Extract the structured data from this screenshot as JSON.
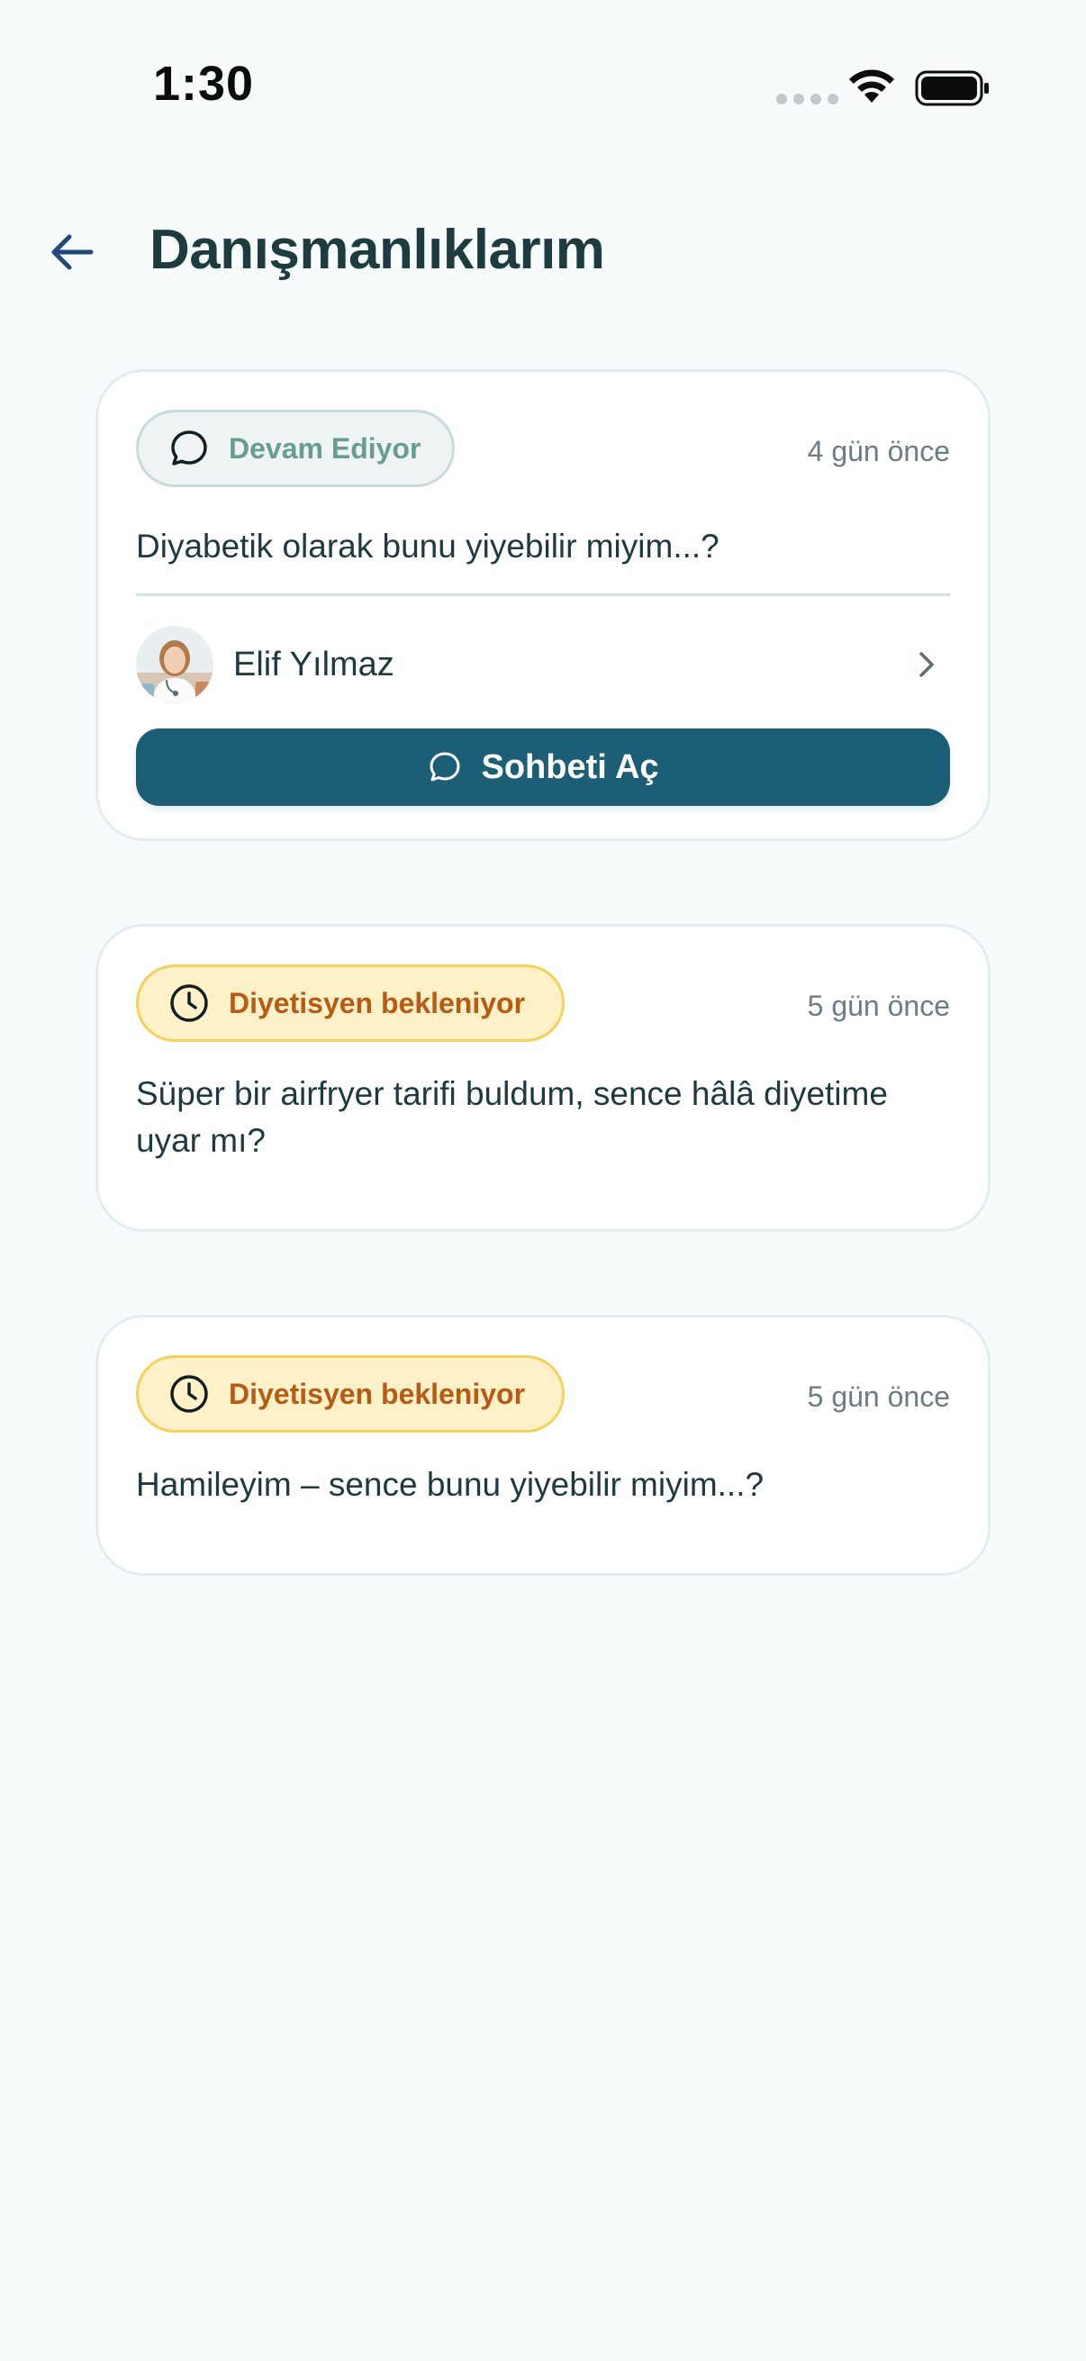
{
  "status_bar": {
    "time": "1:30"
  },
  "header": {
    "title": "Danışmanlıklarım",
    "back_icon": "arrow-left-icon"
  },
  "consultations": [
    {
      "status_label": "Devam Ediyor",
      "status_icon": "chat-bubble-icon",
      "time_ago": "4 gün önce",
      "question": "Diyabetik olarak bunu yiyebilir miyim...?",
      "dietitian_name": "Elif Yılmaz",
      "button_label": "Sohbeti Aç",
      "button_icon": "chat-bubble-icon"
    },
    {
      "status_label": "Diyetisyen bekleniyor",
      "status_icon": "clock-icon",
      "time_ago": "5 gün önce",
      "question": "Süper bir airfryer tarifi buldum, sence hâlâ diyetime uyar mı?"
    },
    {
      "status_label": "Diyetisyen bekleniyor",
      "status_icon": "clock-icon",
      "time_ago": "5 gün önce",
      "question": "Hamileyim – sence bunu yiyebilir miyim...?"
    }
  ],
  "colors": {
    "background": "#f7fbfc",
    "primary": "#1d5e77",
    "active_badge_text": "#6b9c92",
    "waiting_badge_bg": "#fef1c8",
    "waiting_badge_text": "#b65a14"
  }
}
